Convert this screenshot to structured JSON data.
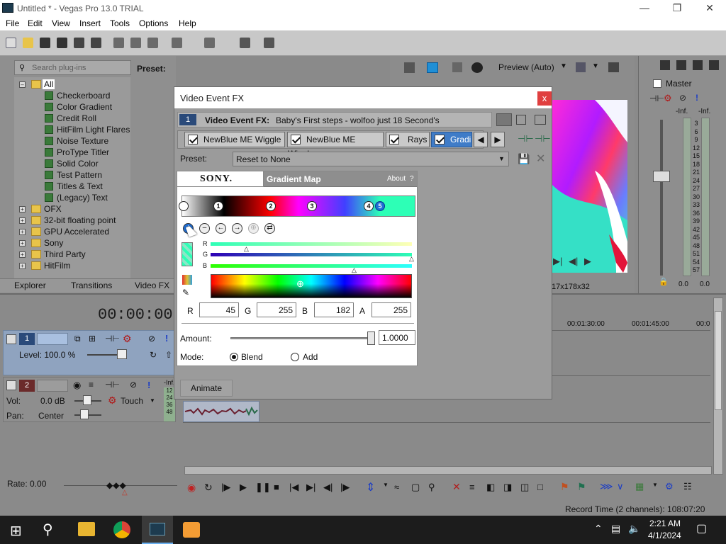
{
  "window": {
    "title": "Untitled * - Vegas Pro 13.0 TRIAL"
  },
  "menu": [
    "File",
    "Edit",
    "View",
    "Insert",
    "Tools",
    "Options",
    "Help"
  ],
  "plugins": {
    "search_placeholder": "Search plug-ins",
    "preset_label": "Preset:",
    "root": "All",
    "items": [
      "Checkerboard",
      "Color Gradient",
      "Credit Roll",
      "HitFilm Light Flares",
      "Noise Texture",
      "ProType Titler",
      "Solid Color",
      "Test Pattern",
      "Titles & Text",
      "(Legacy) Text"
    ],
    "folders": [
      "OFX",
      "32-bit floating point",
      "GPU Accelerated",
      "Sony",
      "Third Party",
      "HitFilm"
    ],
    "tabs": [
      "Explorer",
      "Transitions",
      "Video FX"
    ]
  },
  "preview": {
    "mode": "Preview (Auto)",
    "resolution": "17x178x32"
  },
  "master": {
    "label": "Master",
    "inf_left": "-Inf.",
    "inf_right": "-Inf.",
    "scale": [
      "3",
      "6",
      "9",
      "12",
      "15",
      "18",
      "21",
      "24",
      "27",
      "30",
      "33",
      "36",
      "39",
      "42",
      "45",
      "48",
      "51",
      "54",
      "57"
    ],
    "bottom_left": "0.0",
    "bottom_right": "0.0"
  },
  "dialog": {
    "title": "Video Event FX",
    "close": "x",
    "event_label": "Video Event FX:",
    "event_name": "Baby's First steps - wolfoo just 18 Second's",
    "track_number": "1",
    "chain": [
      "NewBlue ME Wiggle",
      "NewBlue ME Wiggle",
      "Rays",
      "Gradi"
    ],
    "preset_label": "Preset:",
    "preset_value": "Reset to None",
    "brand": "SONY.",
    "plugin_name": "Gradient Map",
    "about": "About",
    "help": "?",
    "stops": [
      "1",
      "2",
      "3",
      "4",
      "5"
    ],
    "channels": [
      "R",
      "G",
      "B"
    ],
    "rgba": {
      "r_label": "R",
      "r": "45",
      "g_label": "G",
      "g": "255",
      "b_label": "B",
      "b": "182",
      "a_label": "A",
      "a": "255"
    },
    "amount_label": "Amount:",
    "amount": "1.0000",
    "amount_fraction": 1.0,
    "mode_label": "Mode:",
    "modes": [
      "Blend",
      "Add"
    ],
    "mode_selected": "Blend",
    "animate": "Animate"
  },
  "timeline": {
    "timecode": "00:00:00:00",
    "ticks": [
      "00:01:30:00",
      "00:01:45:00",
      "00:0"
    ],
    "track1": {
      "number": "1",
      "level": "Level: 100.0 %"
    },
    "track2": {
      "number": "2",
      "vol_label": "Vol:",
      "vol": "0.0 dB",
      "pan_label": "Pan:",
      "pan": "Center",
      "touch": "Touch",
      "inf": "-Inf.",
      "meter": [
        "12",
        "24",
        "36",
        "48"
      ]
    },
    "rate": "Rate: 0.00"
  },
  "status": {
    "record_time": "Record Time (2 channels): 108:07:20"
  },
  "taskbar": {
    "time": "2:21 AM",
    "date": "4/1/2024"
  },
  "colors": {
    "accent": "#1f6fd6",
    "dialog_bg": "#9b9b9b",
    "close": "#e04040"
  }
}
